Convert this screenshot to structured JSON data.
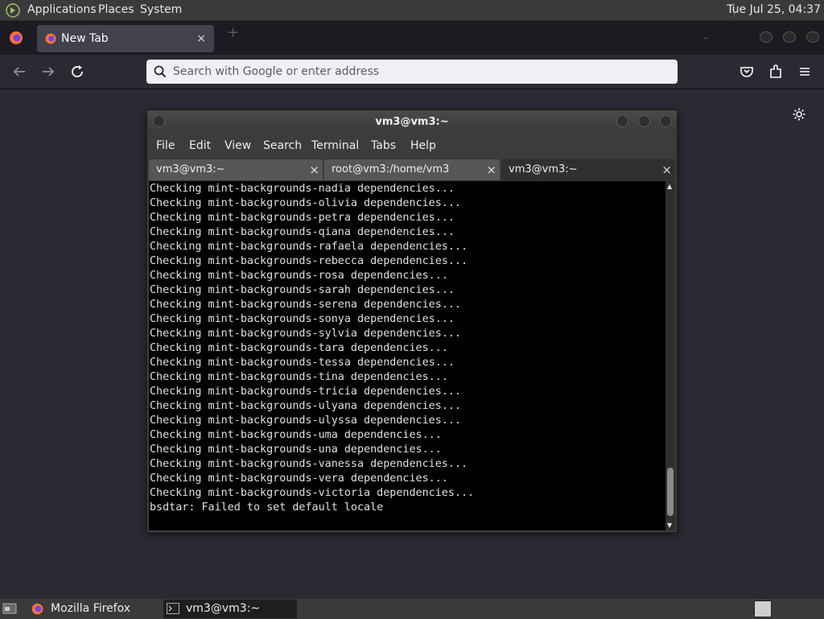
{
  "top_panel": {
    "menus": [
      "Applications",
      "Places",
      "System"
    ],
    "clock": "Tue Jul 25, 04:37"
  },
  "firefox": {
    "tab": {
      "title": "New Tab",
      "close": "×"
    },
    "new_tab": "+",
    "urlbar_placeholder": "Search with Google or enter address"
  },
  "terminal": {
    "title": "vm3@vm3:~",
    "menu": [
      "File",
      "Edit",
      "View",
      "Search",
      "Terminal",
      "Tabs",
      "Help"
    ],
    "tabs": [
      {
        "label": "vm3@vm3:~",
        "close": "×"
      },
      {
        "label": "root@vm3:/home/vm3",
        "close": "×"
      },
      {
        "label": "vm3@vm3:~",
        "close": "×"
      }
    ],
    "lines": [
      "Checking mint-backgrounds-nadia dependencies...",
      "Checking mint-backgrounds-olivia dependencies...",
      "Checking mint-backgrounds-petra dependencies...",
      "Checking mint-backgrounds-qiana dependencies...",
      "Checking mint-backgrounds-rafaela dependencies...",
      "Checking mint-backgrounds-rebecca dependencies...",
      "Checking mint-backgrounds-rosa dependencies...",
      "Checking mint-backgrounds-sarah dependencies...",
      "Checking mint-backgrounds-serena dependencies...",
      "Checking mint-backgrounds-sonya dependencies...",
      "Checking mint-backgrounds-sylvia dependencies...",
      "Checking mint-backgrounds-tara dependencies...",
      "Checking mint-backgrounds-tessa dependencies...",
      "Checking mint-backgrounds-tina dependencies...",
      "Checking mint-backgrounds-tricia dependencies...",
      "Checking mint-backgrounds-ulyana dependencies...",
      "Checking mint-backgrounds-ulyssa dependencies...",
      "Checking mint-backgrounds-uma dependencies...",
      "Checking mint-backgrounds-una dependencies...",
      "Checking mint-backgrounds-vanessa dependencies...",
      "Checking mint-backgrounds-vera dependencies...",
      "Checking mint-backgrounds-victoria dependencies...",
      "bsdtar: Failed to set default locale"
    ]
  },
  "taskbar": {
    "items": [
      "Mozilla Firefox",
      "vm3@vm3:~"
    ]
  }
}
